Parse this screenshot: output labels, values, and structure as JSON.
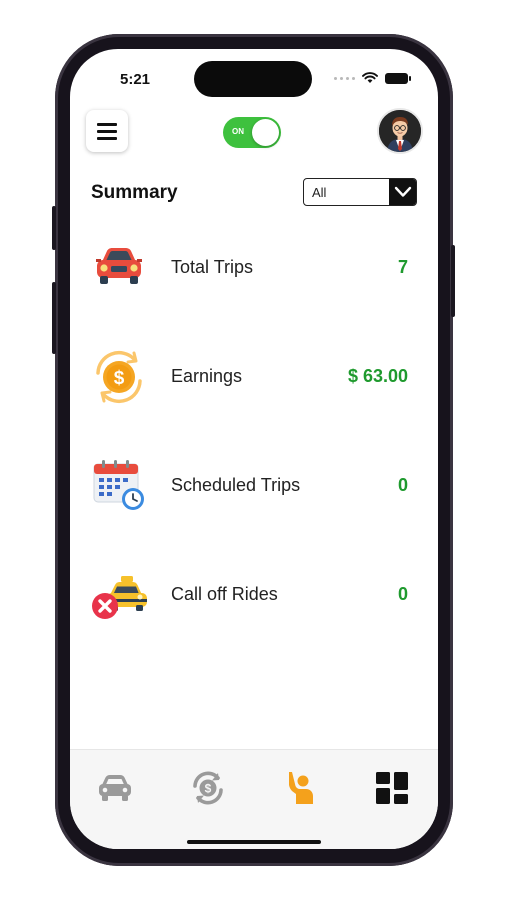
{
  "status_bar": {
    "time": "5:21"
  },
  "header": {
    "toggle_label": "ON",
    "toggle_state": "on"
  },
  "summary": {
    "title": "Summary",
    "filter_value": "All"
  },
  "stats": [
    {
      "label": "Total Trips",
      "value": "7",
      "icon": "car-icon"
    },
    {
      "label": "Earnings",
      "value": "$ 63.00",
      "icon": "dollar-coin-icon"
    },
    {
      "label": "Scheduled Trips",
      "value": "0",
      "icon": "calendar-clock-icon"
    },
    {
      "label": "Call off Rides",
      "value": "0",
      "icon": "taxi-cancel-icon"
    }
  ],
  "tabbar": {
    "tabs": [
      {
        "icon": "car-icon",
        "active": false
      },
      {
        "icon": "earnings-cycle-icon",
        "active": false
      },
      {
        "icon": "passenger-wave-icon",
        "active": true
      },
      {
        "icon": "dashboard-grid-icon",
        "active": false
      }
    ]
  },
  "colors": {
    "accent_green": "#3ec13e",
    "value_green": "#1f9a2e",
    "active_tab": "#f4a11c",
    "inactive_tab": "#9a9a9a"
  }
}
